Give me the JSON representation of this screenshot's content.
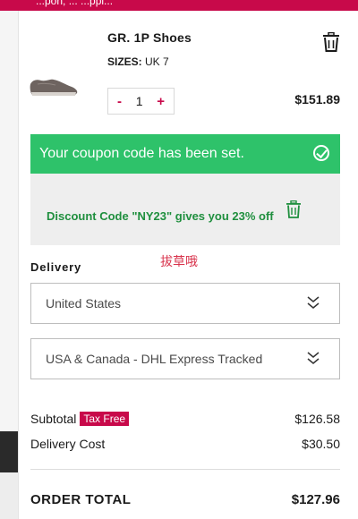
{
  "banner": {
    "text": "...pon, ... ...ppi..."
  },
  "cart_item": {
    "name": "GR. 1P Shoes",
    "sizes_label": "SIZES:",
    "sizes_value": "UK 7",
    "qty_minus": "-",
    "quantity": "1",
    "qty_plus": "+",
    "price": "$151.89"
  },
  "coupon": {
    "success_message": "Your coupon code has been set.",
    "discount_text": "Discount Code \"NY23\" gives you 23% off"
  },
  "annotation": "拔草哦",
  "delivery": {
    "label": "Delivery",
    "country": "United States",
    "method": "USA & Canada - DHL Express Tracked"
  },
  "summary": {
    "subtotal_label": "Subtotal",
    "tax_badge": "Tax Free",
    "subtotal_value": "$126.58",
    "delivery_cost_label": "Delivery Cost",
    "delivery_cost_value": "$30.50",
    "order_total_label": "ORDER TOTAL",
    "order_total_value": "$127.96"
  },
  "colors": {
    "brand": "#c8094a",
    "success": "#2ec26a",
    "discount_text": "#1f8f3e",
    "annotation": "#d8324b"
  },
  "icons": [
    "trash-icon",
    "check-circle-icon",
    "chevron-down-icon",
    "shoe-image"
  ]
}
